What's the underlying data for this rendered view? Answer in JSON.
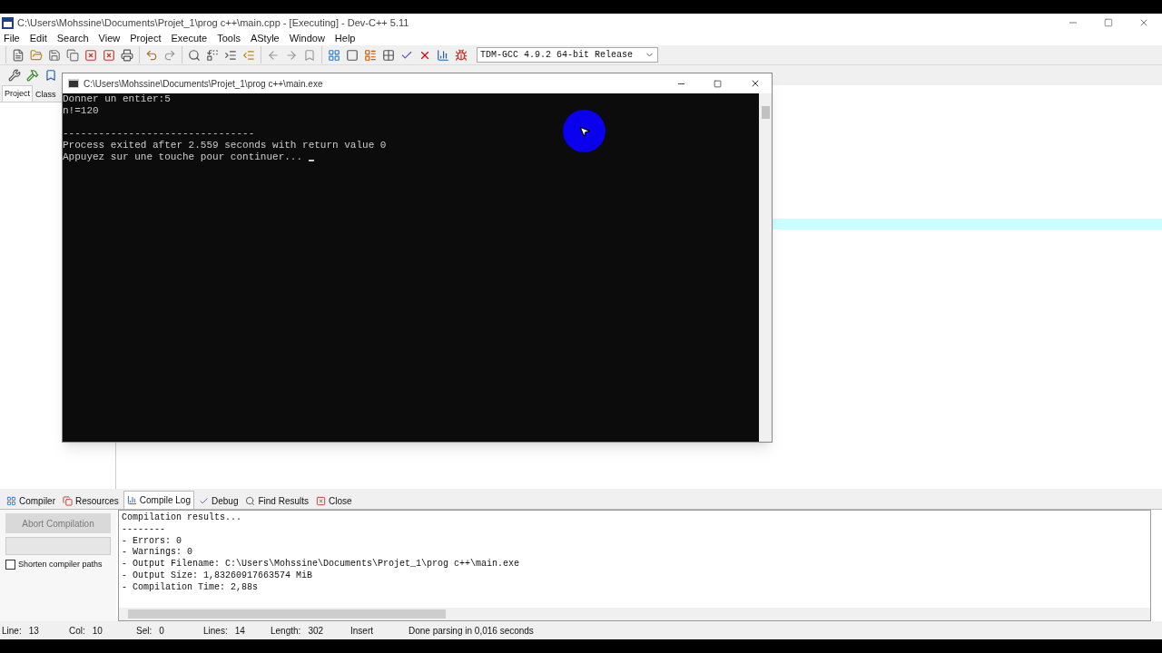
{
  "window": {
    "title": "C:\\Users\\Mohssine\\Documents\\Projet_1\\prog c++\\main.cpp - [Executing] - Dev-C++ 5.11"
  },
  "menu": [
    "File",
    "Edit",
    "Search",
    "View",
    "Project",
    "Execute",
    "Tools",
    "AStyle",
    "Window",
    "Help"
  ],
  "compiler_select": {
    "value": "TDM-GCC 4.9.2 64-bit Release"
  },
  "left_tabs": [
    {
      "label": "Project",
      "selected": true
    },
    {
      "label": "Class",
      "selected": false
    }
  ],
  "console": {
    "title": "C:\\Users\\Mohssine\\Documents\\Projet_1\\prog c++\\main.exe",
    "output": [
      "Donner un entier:5",
      "n!=120"
    ],
    "footer": [
      "--------------------------------",
      "Process exited after 2.559 seconds with return value 0",
      "Appuyez sur une touche pour continuer... "
    ]
  },
  "bottom_tabs": [
    {
      "label": "Compiler",
      "selected": false
    },
    {
      "label": "Resources",
      "selected": false
    },
    {
      "label": "Compile Log",
      "selected": true
    },
    {
      "label": "Debug",
      "selected": false
    },
    {
      "label": "Find Results",
      "selected": false
    },
    {
      "label": "Close",
      "selected": false
    }
  ],
  "abort_button": {
    "label": "Abort Compilation",
    "disabled": true
  },
  "progress": {
    "level": 0
  },
  "shorten_paths": {
    "label": "Shorten compiler paths",
    "checked": false
  },
  "compile_log": [
    "Compilation results...",
    "--------",
    "- Errors: 0",
    "- Warnings: 0",
    "- Output Filename: C:\\Users\\Mohssine\\Documents\\Projet_1\\prog c++\\main.exe",
    "- Output Size: 1,83260917663574 MiB",
    "- Compilation Time: 2,88s"
  ],
  "status_bar": {
    "fields": [
      {
        "label": "Line:",
        "value": "13"
      },
      {
        "label": "Col:",
        "value": "10"
      },
      {
        "label": "Sel:",
        "value": "0"
      },
      {
        "label": "Lines:",
        "value": "14"
      },
      {
        "label": "Length:",
        "value": "302"
      }
    ],
    "mode": "Insert",
    "message": "Done parsing in 0,016 seconds"
  }
}
